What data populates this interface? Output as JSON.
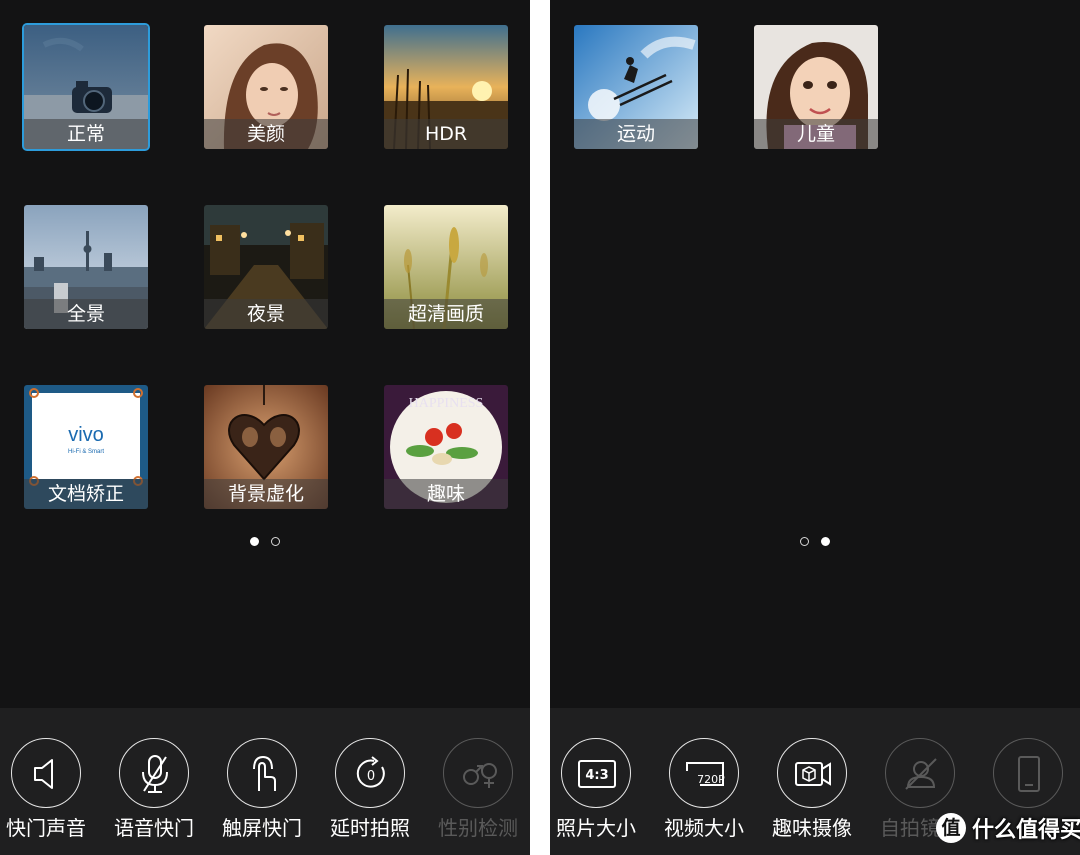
{
  "left_screen": {
    "modes": [
      {
        "label": "正常"
      },
      {
        "label": "美颜"
      },
      {
        "label": "HDR"
      },
      {
        "label": "全景"
      },
      {
        "label": "夜景"
      },
      {
        "label": "超清画质"
      },
      {
        "label": "文档矫正",
        "art_text": "vivo",
        "art_subtext": "Hi-Fi & Smart"
      },
      {
        "label": "背景虚化"
      },
      {
        "label": "趣味",
        "art_text": "HAPPINESS"
      }
    ],
    "page_dots": {
      "count": 2,
      "active": 1
    },
    "settings": [
      {
        "label": "快门声音",
        "icon": "speaker-icon",
        "enabled": true
      },
      {
        "label": "语音快门",
        "icon": "microphone-icon",
        "enabled": true
      },
      {
        "label": "触屏快门",
        "icon": "touch-icon",
        "enabled": true
      },
      {
        "label": "延时拍照",
        "icon": "timer-icon",
        "icon_text": "0",
        "enabled": true
      },
      {
        "label": "性别检测",
        "icon": "gender-icon",
        "enabled": false
      }
    ]
  },
  "right_screen": {
    "modes": [
      {
        "label": "运动"
      },
      {
        "label": "儿童"
      }
    ],
    "page_dots": {
      "count": 2,
      "active": 2
    },
    "settings": [
      {
        "label": "照片大小",
        "icon": "aspect-ratio-icon",
        "icon_text": "4:3",
        "enabled": true
      },
      {
        "label": "视频大小",
        "icon": "video-resolution-icon",
        "icon_text": "720P",
        "enabled": true
      },
      {
        "label": "趣味摄像",
        "icon": "fun-video-icon",
        "enabled": true
      },
      {
        "label": "自拍镜像",
        "icon": "selfie-mirror-icon",
        "enabled": false
      },
      {
        "label": "",
        "icon": "phone-icon",
        "enabled": false
      }
    ]
  },
  "watermark": {
    "badge": "值",
    "text": "什么值得买"
  },
  "colors": {
    "background": "#131314",
    "bottom_bar": "#1f1f20",
    "selected_border": "#2d9cdb",
    "disabled": "#5a5a5a"
  }
}
